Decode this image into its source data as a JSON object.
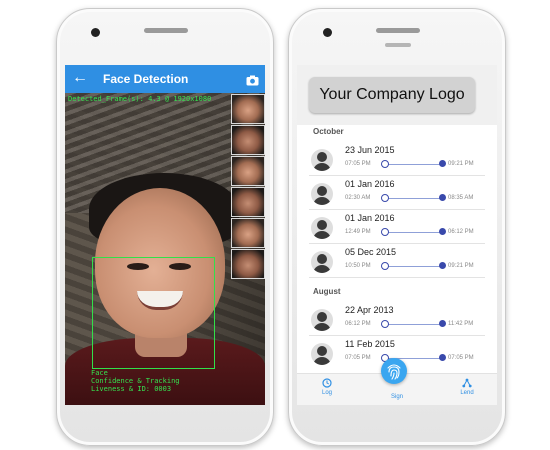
{
  "left_phone": {
    "app_bar": {
      "title": "Face Detection",
      "back_icon": "arrow-left-icon",
      "action_icon": "camera-icon"
    },
    "overlay": {
      "frames_text": "Detected_Frame(s): 4.3 @ 1920x1080",
      "box_label_1": "Face",
      "box_label_2": "Confidence & Tracking",
      "box_label_3": "Liveness & ID: 0003"
    },
    "thumbnails": [
      "face-1",
      "face-2",
      "face-3",
      "face-4",
      "face-5",
      "face-6"
    ]
  },
  "right_phone": {
    "logo_text": "Your Company Logo",
    "sections": [
      {
        "label": "October",
        "entries": [
          {
            "date": "23 Jun 2015",
            "start": "07:05 PM",
            "end": "09:21 PM"
          },
          {
            "date": "01 Jan 2016",
            "start": "02:30 AM",
            "end": "08:35 AM"
          },
          {
            "date": "01 Jan 2016",
            "start": "12:49 PM",
            "end": "06:12 PM"
          },
          {
            "date": "05 Dec 2015",
            "start": "10:50 PM",
            "end": "09:21 PM"
          }
        ]
      },
      {
        "label": "August",
        "entries": [
          {
            "date": "22 Apr 2013",
            "start": "06:12 PM",
            "end": "11:42 PM"
          },
          {
            "date": "11 Feb 2015",
            "start": "07:05 PM",
            "end": "07:05 PM"
          }
        ]
      }
    ],
    "nav": {
      "log": "Log",
      "sign": "Sign",
      "lend": "Lend"
    },
    "colors": {
      "accent": "#2f8fe3",
      "slider": "#3949ab"
    }
  }
}
